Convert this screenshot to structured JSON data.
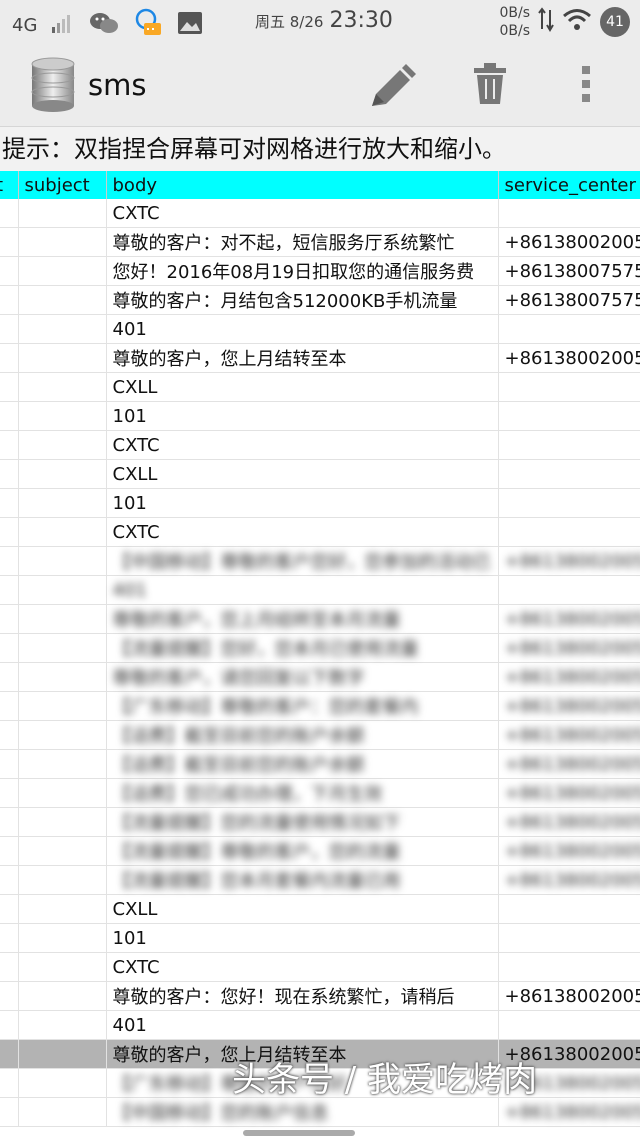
{
  "statusbar": {
    "network": "4G",
    "date": "周五 8/26",
    "time": "23:30",
    "speed_up": "0B/s",
    "speed_down": "0B/s",
    "battery": "41"
  },
  "toolbar": {
    "title": "sms"
  },
  "hint": "提示：双指捏合屏幕可对网格进行放大和缩小。",
  "table": {
    "columns": [
      "t",
      "subject",
      "body",
      "service_center"
    ],
    "rows": [
      {
        "body": "CXTC",
        "service_center": ""
      },
      {
        "body": "尊敬的客户：对不起，短信服务厅系统繁忙",
        "service_center": "+86138002005"
      },
      {
        "body": "您好！2016年08月19日扣取您的通信服务费",
        "service_center": "+86138007575"
      },
      {
        "body": "尊敬的客户：月结包含512000KB手机流量",
        "service_center": "+86138007575"
      },
      {
        "body": "401",
        "service_center": ""
      },
      {
        "body": "尊敬的客户，您上月结转至本",
        "service_center": "+86138002005"
      },
      {
        "body": "CXLL",
        "service_center": ""
      },
      {
        "body": "101",
        "service_center": ""
      },
      {
        "body": "CXTC",
        "service_center": ""
      },
      {
        "body": "CXLL",
        "service_center": ""
      },
      {
        "body": "101",
        "service_center": ""
      },
      {
        "body": "CXTC",
        "service_center": ""
      },
      {
        "body": "【中国移动】尊敬的客户您好，您参加的活动已",
        "service_center": "+86138002005",
        "blurred": true
      },
      {
        "body": "401",
        "service_center": "",
        "blurred": true
      },
      {
        "body": "尊敬的客户，您上月结转至本月流量",
        "service_center": "+86138002005",
        "blurred": true
      },
      {
        "body": "【流量提醒】您好，您本月已使用流量",
        "service_center": "+86138002005",
        "blurred": true
      },
      {
        "body": "尊敬的客户，请您回复以下数字",
        "service_center": "+86138002005",
        "blurred": true
      },
      {
        "body": "【广东移动】尊敬的客户：您的套餐内",
        "service_center": "+86138002005",
        "blurred": true
      },
      {
        "body": "【话费】截至目前您的账户余额",
        "service_center": "+86138002005",
        "blurred": true
      },
      {
        "body": "【话费】截至目前您的账户余额",
        "service_center": "+86138002005",
        "blurred": true
      },
      {
        "body": "【话费】您已成功办理，下月生效",
        "service_center": "+86138002005",
        "blurred": true
      },
      {
        "body": "【流量提醒】您的流量使用情况如下",
        "service_center": "+86138002005",
        "blurred": true
      },
      {
        "body": "【流量提醒】尊敬的客户，您的流量",
        "service_center": "+86138002005",
        "blurred": true
      },
      {
        "body": "【流量提醒】您本月套餐内流量已用",
        "service_center": "+86138002005",
        "blurred": true
      },
      {
        "body": "CXLL",
        "service_center": ""
      },
      {
        "body": "101",
        "service_center": ""
      },
      {
        "body": "CXTC",
        "service_center": ""
      },
      {
        "body": "尊敬的客户：您好！现在系统繁忙，请稍后",
        "service_center": "+86138002005"
      },
      {
        "body": "401",
        "service_center": ""
      },
      {
        "body": "尊敬的客户，您上月结转至本",
        "service_center": "+86138002005",
        "selected": true
      },
      {
        "body": "【广东移动】尊敬的客户您好",
        "service_center": "+86138002005",
        "blurred": true
      },
      {
        "body": "【中国移动】您的账户信息",
        "service_center": "+86138002005",
        "blurred": true
      }
    ]
  },
  "watermark": "头条号 / 我爱吃烤肉"
}
